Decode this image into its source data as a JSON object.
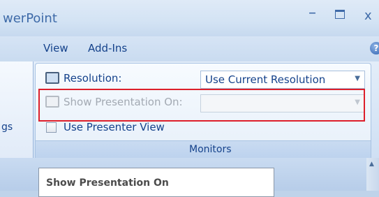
{
  "window": {
    "title": "werPoint",
    "minimize_glyph": "–",
    "close_glyph": "x"
  },
  "tabs": [
    {
      "label": "View"
    },
    {
      "label": "Add-Ins"
    }
  ],
  "help_icon": "?",
  "left_group": {
    "label_fragment": "gs"
  },
  "monitors": {
    "resolution_label": "Resolution:",
    "resolution_value": "Use Current Resolution",
    "show_on_label": "Show Presentation On:",
    "show_on_value": "",
    "presenter_view_label": "Use Presenter View",
    "presenter_view_checked": false,
    "group_caption": "Monitors"
  },
  "tooltip": {
    "title": "Show Presentation On"
  },
  "colors": {
    "highlight": "#dd1f2b",
    "ribbon_text": "#15428b"
  }
}
